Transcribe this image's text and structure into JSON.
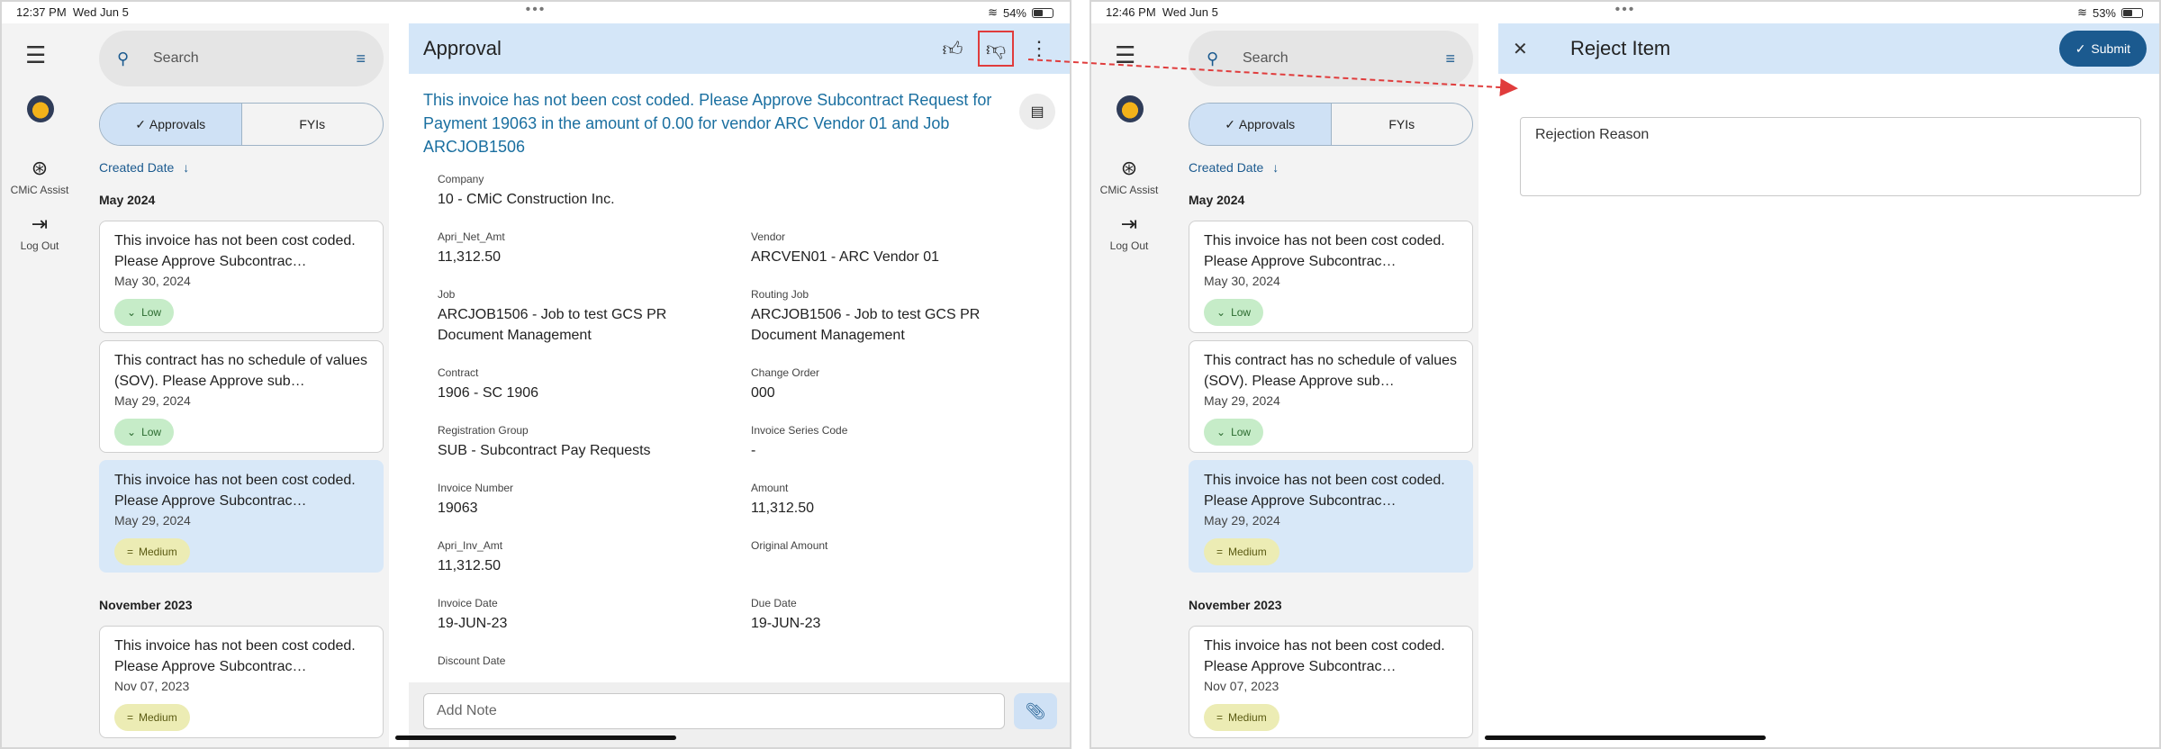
{
  "left": {
    "status": {
      "time": "12:37 PM",
      "date": "Wed Jun 5",
      "battery": "54%"
    },
    "rail": {
      "assist": "CMiC Assist",
      "logout": "Log Out"
    },
    "search_placeholder": "Search",
    "tabs": {
      "approvals": "Approvals",
      "fyis": "FYIs"
    },
    "sort_label": "Created Date",
    "groups": {
      "may": "May 2024",
      "nov": "November 2023"
    },
    "cards": [
      {
        "text": "This invoice has not been cost coded. Please Approve Subcontrac…",
        "date": "May 30, 2024",
        "priority": "Low"
      },
      {
        "text": "This contract has no schedule of values (SOV).  Please Approve sub…",
        "date": "May 29, 2024",
        "priority": "Low"
      },
      {
        "text": "This invoice has not been cost coded. Please Approve Subcontrac…",
        "date": "May 29, 2024",
        "priority": "Medium"
      },
      {
        "text": "This invoice has not been cost coded. Please Approve Subcontrac…",
        "date": "Nov 07, 2023",
        "priority": "Medium"
      }
    ],
    "detail": {
      "title": "Approval",
      "summary": "This invoice has not been cost coded. Please Approve Subcontract Request for Payment 19063 in the amount of 0.00 for vendor ARC Vendor 01 and Job ARCJOB1506",
      "fields": {
        "company": {
          "label": "Company",
          "value": "10 - CMiC Construction Inc."
        },
        "apri_net_amt": {
          "label": "Apri_Net_Amt",
          "value": "11,312.50"
        },
        "vendor": {
          "label": "Vendor",
          "value": "ARCVEN01 - ARC Vendor 01"
        },
        "job": {
          "label": "Job",
          "value": "ARCJOB1506 - Job to test GCS PR Document Management"
        },
        "routing_job": {
          "label": "Routing Job",
          "value": "ARCJOB1506 - Job to test GCS PR Document Management"
        },
        "contract": {
          "label": "Contract",
          "value": "1906 - SC 1906"
        },
        "change_order": {
          "label": "Change Order",
          "value": "000"
        },
        "registration_group": {
          "label": "Registration Group",
          "value": "SUB - Subcontract Pay Requests"
        },
        "invoice_series_code": {
          "label": "Invoice Series Code",
          "value": "-"
        },
        "invoice_number": {
          "label": "Invoice Number",
          "value": "19063"
        },
        "amount": {
          "label": "Amount",
          "value": "11,312.50"
        },
        "apri_inv_amt": {
          "label": "Apri_Inv_Amt",
          "value": "11,312.50"
        },
        "original_amount": {
          "label": "Original Amount",
          "value": ""
        },
        "invoice_date": {
          "label": "Invoice Date",
          "value": "19-JUN-23"
        },
        "due_date": {
          "label": "Due Date",
          "value": "19-JUN-23"
        },
        "discount_date": {
          "label": "Discount Date",
          "value": ""
        }
      },
      "note_placeholder": "Add Note"
    }
  },
  "right": {
    "status": {
      "time": "12:46 PM",
      "date": "Wed Jun 5",
      "battery": "53%"
    },
    "rail": {
      "assist": "CMiC Assist",
      "logout": "Log Out"
    },
    "search_placeholder": "Search",
    "tabs": {
      "approvals": "Approvals",
      "fyis": "FYIs"
    },
    "sort_label": "Created Date",
    "groups": {
      "may": "May 2024",
      "nov": "November 2023"
    },
    "cards": [
      {
        "text": "This invoice has not been cost coded. Please Approve Subcontrac…",
        "date": "May 30, 2024",
        "priority": "Low"
      },
      {
        "text": "This contract has no schedule of values (SOV).  Please Approve sub…",
        "date": "May 29, 2024",
        "priority": "Low"
      },
      {
        "text": "This invoice has not been cost coded. Please Approve Subcontrac…",
        "date": "May 29, 2024",
        "priority": "Medium"
      },
      {
        "text": "This invoice has not been cost coded. Please Approve Subcontrac…",
        "date": "Nov 07, 2023",
        "priority": "Medium"
      }
    ],
    "reject": {
      "title": "Reject Item",
      "submit": "Submit",
      "reason_placeholder": "Rejection Reason"
    }
  },
  "colors": {
    "accent": "#1b5a8f",
    "header_bg": "#d4e6f8",
    "highlight": "#e03c3c",
    "low_badge": "#c6ecc8",
    "medium_badge": "#ececb4"
  }
}
